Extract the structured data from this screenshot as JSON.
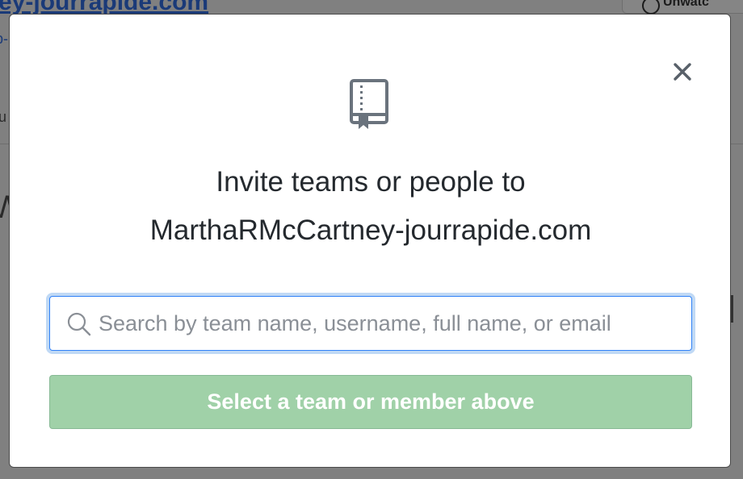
{
  "background": {
    "repo_title": "ey-jourrapide.com",
    "subline": "p-",
    "frag_tab": "u",
    "frag_heading": "W",
    "unwatch_label": "Unwatc"
  },
  "modal": {
    "icon": "repo-book-icon",
    "close_icon": "close-icon",
    "title_line1": "Invite teams or people to",
    "title_line2": "MarthaRMcCartney-jourrapide.com",
    "search": {
      "placeholder": "Search by team name, username, full name, or email",
      "value": "",
      "icon": "search-icon"
    },
    "submit_label": "Select a team or member above",
    "submit_disabled": true
  },
  "colors": {
    "overlay": "#808080",
    "focus_border": "#2f81f7",
    "button_disabled_bg": "#a0d1a8",
    "text": "#24292e"
  }
}
